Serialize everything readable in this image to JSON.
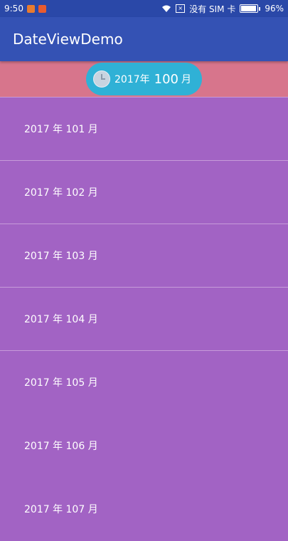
{
  "status_bar": {
    "time": "9:50",
    "carrier_text": "没有 SIM 卡",
    "battery": "96%",
    "battery_level": 0.96,
    "app_icon_colors": [
      "#e87b2f",
      "#e85b2f"
    ]
  },
  "app_bar": {
    "title": "DateViewDemo",
    "color": "#3452b4"
  },
  "date_picker": {
    "year": "2017年",
    "month": "100",
    "month_unit": "月",
    "icon": "clock-icon",
    "color": "#2fb1d6"
  },
  "list": {
    "items": [
      {
        "label": "2017 年 101 月"
      },
      {
        "label": "2017 年 102 月"
      },
      {
        "label": "2017 年 103 月"
      },
      {
        "label": "2017 年 104 月"
      },
      {
        "label": "2017 年 105 月"
      },
      {
        "label": "2017 年 106 月"
      },
      {
        "label": "2017 年 107 月"
      }
    ]
  },
  "colors": {
    "list_background": "#a263c4",
    "header_band": "#d7758c"
  }
}
